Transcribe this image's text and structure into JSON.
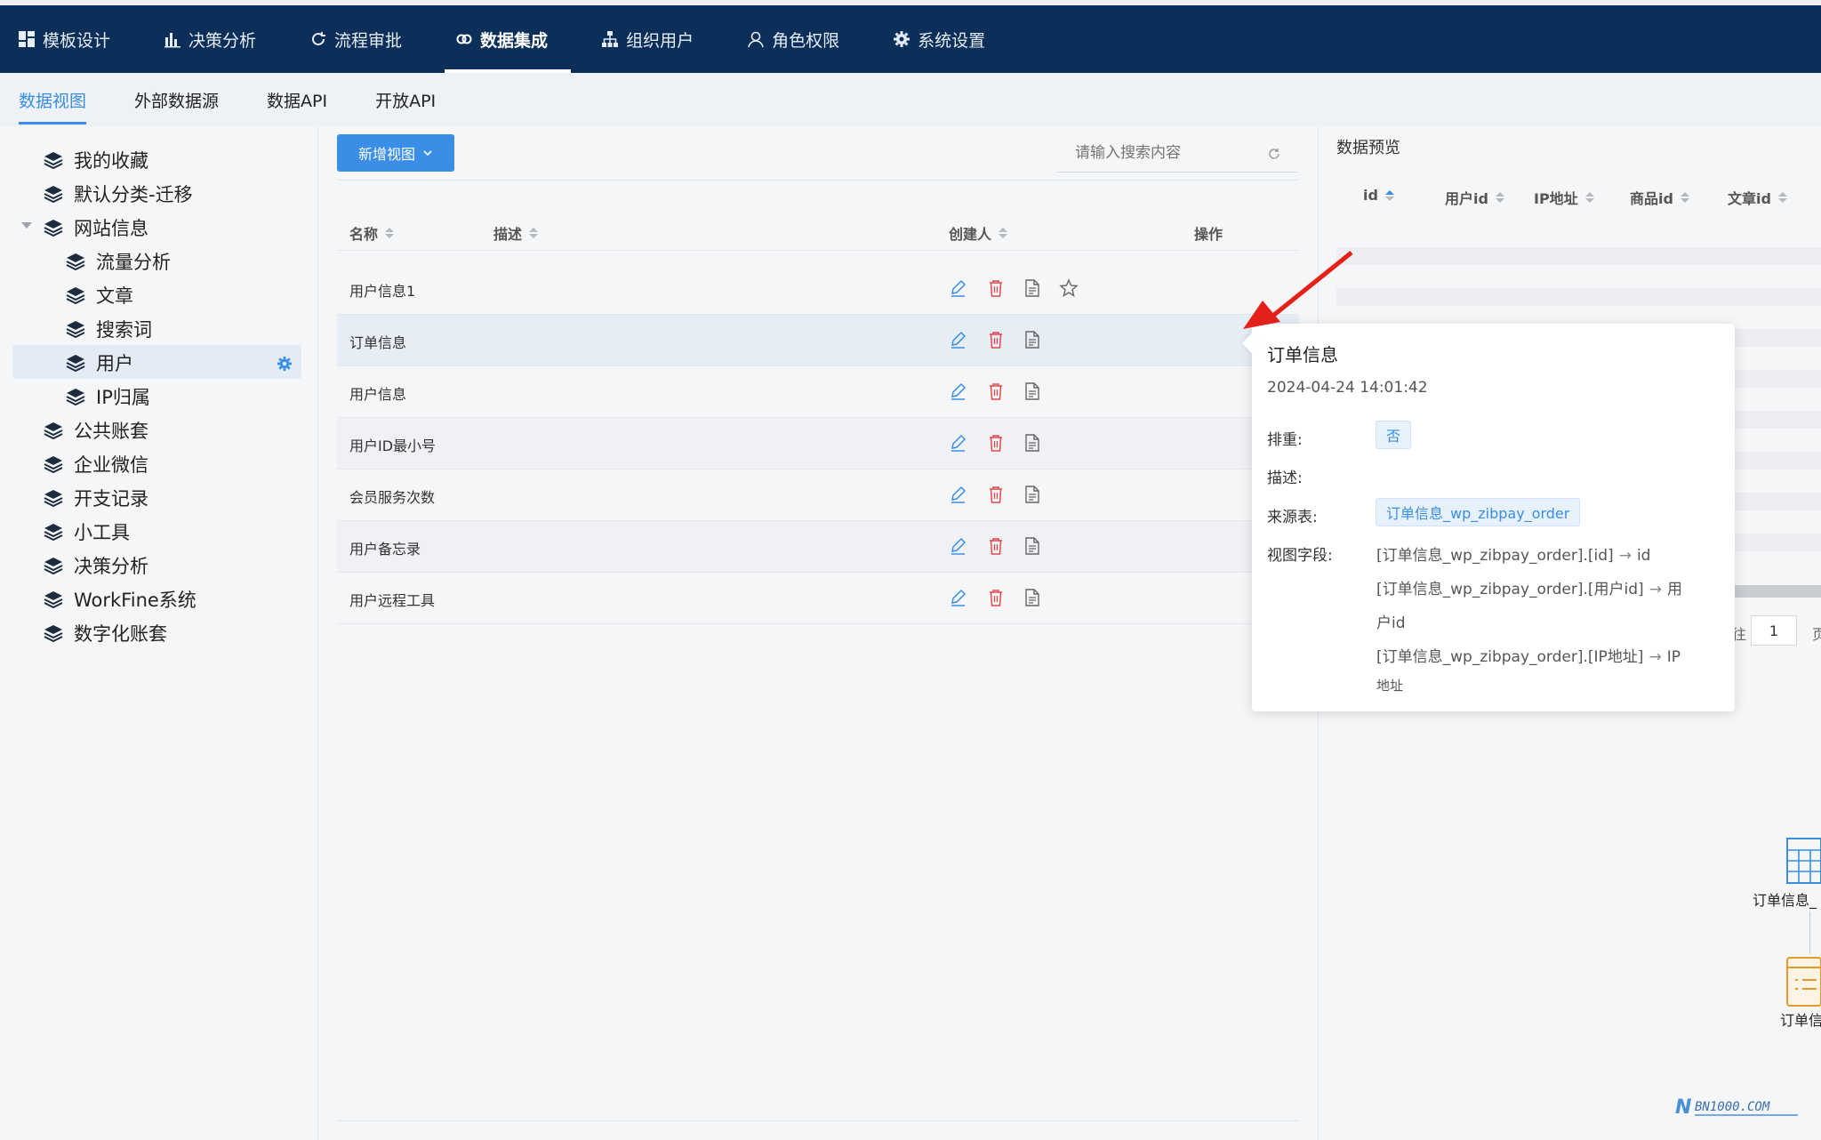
{
  "topnav": {
    "items": [
      {
        "label": "模板设计",
        "icon": "dashboard-icon"
      },
      {
        "label": "决策分析",
        "icon": "bar-chart-icon"
      },
      {
        "label": "流程审批",
        "icon": "cycle-icon"
      },
      {
        "label": "数据集成",
        "icon": "link-icon",
        "active": true
      },
      {
        "label": "组织用户",
        "icon": "org-chart-icon"
      },
      {
        "label": "角色权限",
        "icon": "user-icon"
      },
      {
        "label": "系统设置",
        "icon": "gear-icon"
      }
    ]
  },
  "subtabs": {
    "items": [
      {
        "label": "数据视图",
        "active": true
      },
      {
        "label": "外部数据源"
      },
      {
        "label": "数据API"
      },
      {
        "label": "开放API"
      }
    ]
  },
  "tree": {
    "items": [
      {
        "label": "我的收藏"
      },
      {
        "label": "默认分类-迁移"
      },
      {
        "label": "网站信息",
        "expanded": true
      },
      {
        "label": "流量分析"
      },
      {
        "label": "文章"
      },
      {
        "label": "搜索词"
      },
      {
        "label": "用户",
        "selected": true
      },
      {
        "label": "IP归属"
      },
      {
        "label": "公共账套"
      },
      {
        "label": "企业微信"
      },
      {
        "label": "开支记录"
      },
      {
        "label": "小工具"
      },
      {
        "label": "决策分析"
      },
      {
        "label": "WorkFine系统"
      },
      {
        "label": "数字化账套"
      }
    ]
  },
  "toolbar": {
    "new_view_label": "新增视图",
    "search_placeholder": "请输入搜索内容"
  },
  "table": {
    "columns": [
      "名称",
      "描述",
      "创建人",
      "操作"
    ],
    "rows": [
      {
        "name": "用户信息1"
      },
      {
        "name": "订单信息"
      },
      {
        "name": "用户信息"
      },
      {
        "name": "用户ID最小号"
      },
      {
        "name": "会员服务次数"
      },
      {
        "name": "用户备忘录"
      },
      {
        "name": "用户远程工具"
      }
    ]
  },
  "preview": {
    "title": "数据预览",
    "columns": [
      "id",
      "用户id",
      "IP地址",
      "商品id",
      "文章id"
    ],
    "pager_prefix": "往",
    "pager_page": "1",
    "pager_suffix": "页",
    "flow_label_1": "订单信息_",
    "flow_label_2": "订单信"
  },
  "popover": {
    "title": "订单信息",
    "time": "2024-04-24 14:01:42",
    "dedupe_label": "排重:",
    "dedupe_value": "否",
    "desc_label": "描述:",
    "source_label": "来源表:",
    "source_value": "订单信息_wp_zibpay_order",
    "fields_label": "视图字段:",
    "field_lines": [
      "[订单信息_wp_zibpay_order].[id]",
      "id",
      "[订单信息_wp_zibpay_order].[用户id]",
      "用",
      "户id",
      "[订单信息_wp_zibpay_order].[IP地址]",
      "IP",
      "地址"
    ]
  },
  "colors": {
    "topbar": "#0b2f59",
    "accent": "#3a8ee6",
    "delete": "#e04a4a",
    "annotation": "#e3211b"
  },
  "watermark": "BN1000.COM"
}
